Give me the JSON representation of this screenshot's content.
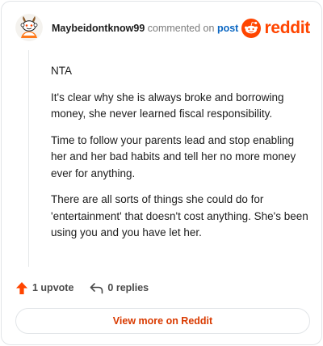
{
  "header": {
    "username": "Maybeidontknow99",
    "commented_text": "commented on",
    "post_link": "post",
    "brand_word": "reddit"
  },
  "comment": {
    "paragraphs": [
      "NTA",
      "It's clear why she is always broke and borrowing money, she never learned fiscal responsibility.",
      "Time to follow your parents lead and stop enabling her and her bad habits and tell her no more money ever for anything.",
      "There are all sorts of things she could do for 'entertainment' that doesn't cost anything. She's been using you and you have let her."
    ]
  },
  "actions": {
    "upvote_label": "1 upvote",
    "replies_label": "0 replies"
  },
  "footer": {
    "view_button": "View more on Reddit"
  },
  "colors": {
    "brand": "#ff4500",
    "link": "#0a66c2",
    "cta": "#d93a00"
  },
  "icons": {
    "avatar": "snoo-avatar-icon",
    "brand": "reddit-logo-icon",
    "upvote": "upvote-arrow-icon",
    "reply": "reply-arrow-icon"
  }
}
